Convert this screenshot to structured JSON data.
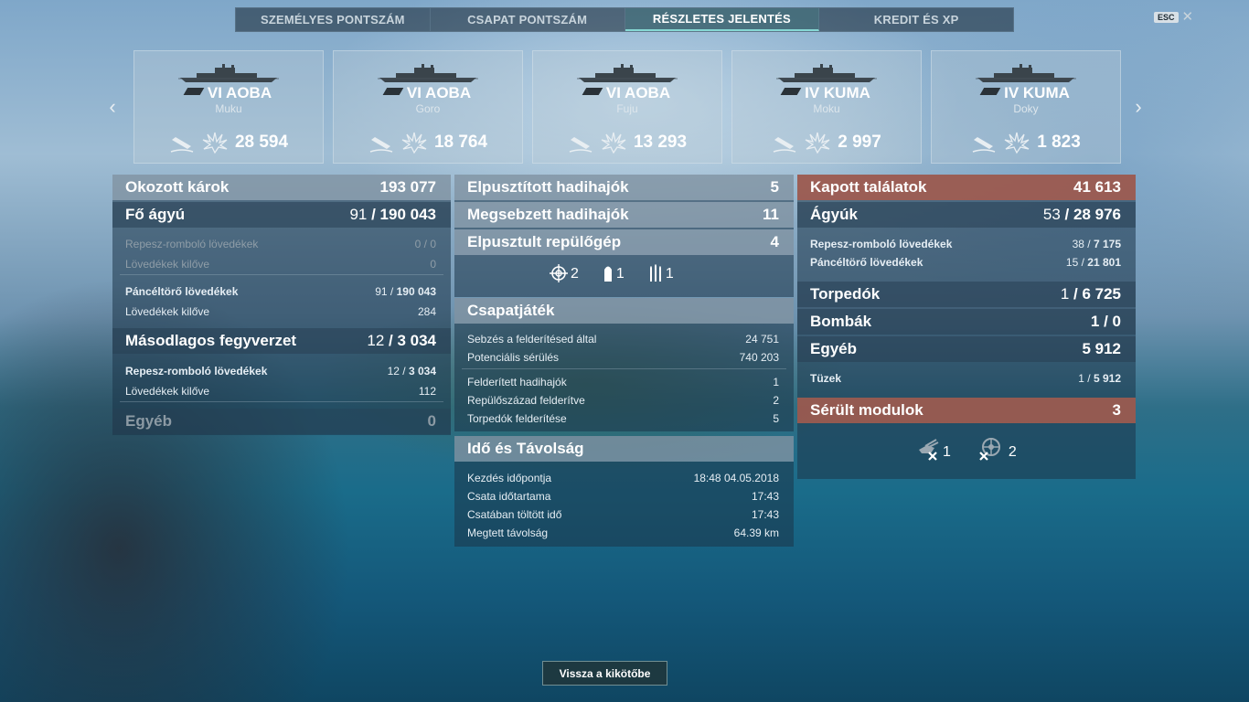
{
  "tabs": [
    "SZEMÉLYES PONTSZÁM",
    "CSAPAT PONTSZÁM",
    "RÉSZLETES JELENTÉS",
    "KREDIT ÉS XP"
  ],
  "active_tab": "RÉSZLETES JELENTÉS",
  "esc_label": "ESC",
  "close_symbol": "✕",
  "nav": {
    "prev": "‹",
    "next": "›"
  },
  "ships": [
    {
      "tier": "VI",
      "name": "AOBA",
      "player": "Muku",
      "damage": "28 594"
    },
    {
      "tier": "VI",
      "name": "AOBA",
      "player": "Goro",
      "damage": "18 764"
    },
    {
      "tier": "VI",
      "name": "AOBA",
      "player": "Fuju",
      "damage": "13 293"
    },
    {
      "tier": "IV",
      "name": "KUMA",
      "player": "Moku",
      "damage": "2 997"
    },
    {
      "tier": "IV",
      "name": "KUMA",
      "player": "Doky",
      "damage": "1 823"
    }
  ],
  "left": {
    "damage_caused": {
      "label": "Okozott károk",
      "value": "193 077"
    },
    "main_guns": {
      "label": "Fő ágyú",
      "hits": "91",
      "total": "190 043"
    },
    "he_main": {
      "label": "Repesz-romboló lövedékek",
      "value": "0 / 0"
    },
    "he_main_fired": {
      "label": "Lövedékek kilőve",
      "value": "0"
    },
    "ap_main": {
      "label": "Páncéltörő lövedékek",
      "hits": "91",
      "total": "190 043"
    },
    "ap_main_fired": {
      "label": "Lövedékek kilőve",
      "value": "284"
    },
    "secondary": {
      "label": "Másodlagos fegyverzet",
      "hits": "12",
      "total": "3 034"
    },
    "he_secondary": {
      "label": "Repesz-romboló lövedékek",
      "hits": "12",
      "total": "3 034"
    },
    "he_secondary_fired": {
      "label": "Lövedékek kilőve",
      "value": "112"
    },
    "other": {
      "label": "Egyéb",
      "value": "0"
    }
  },
  "middle": {
    "destroyed": {
      "label": "Elpusztított hadihajók",
      "value": "5"
    },
    "damaged": {
      "label": "Megsebzett hadihajók",
      "value": "11"
    },
    "planes": {
      "label": "Elpusztult repülőgép",
      "value": "4"
    },
    "medals": {
      "kill_count": "2",
      "shell_count": "1",
      "torpedo_count": "1"
    },
    "teamplay": {
      "title": "Csapatjáték",
      "spotting_damage": {
        "label": "Sebzés a felderítésed által",
        "value": "24 751"
      },
      "potential": {
        "label": "Potenciális sérülés",
        "value": "740 203"
      },
      "spotted_ships": {
        "label": "Felderített hadihajók",
        "value": "1"
      },
      "spotted_squadrons": {
        "label": "Repülőszázad felderítve",
        "value": "2"
      },
      "spotted_torpedoes": {
        "label": "Torpedók felderítése",
        "value": "5"
      }
    },
    "time": {
      "title": "Idő és Távolság",
      "start": {
        "label": "Kezdés időpontja",
        "value": "18:48  04.05.2018"
      },
      "duration": {
        "label": "Csata időtartama",
        "value": "17:43"
      },
      "in_battle": {
        "label": "Csatában töltött idő",
        "value": "17:43"
      },
      "distance": {
        "label": "Megtett távolság",
        "value": "64.39 km"
      }
    }
  },
  "right": {
    "hits_received": {
      "label": "Kapott találatok",
      "value": "41 613"
    },
    "guns": {
      "label": "Ágyúk",
      "hits": "53",
      "total": "28 976"
    },
    "he": {
      "label": "Repesz-romboló lövedékek",
      "hits": "38",
      "total": "7 175"
    },
    "ap": {
      "label": "Páncéltörő lövedékek",
      "hits": "15",
      "total": "21 801"
    },
    "torpedoes": {
      "label": "Torpedók",
      "hits": "1",
      "total": "6 725"
    },
    "bombs": {
      "label": "Bombák",
      "value": "1 / 0"
    },
    "other": {
      "label": "Egyéb",
      "value": "5 912"
    },
    "fires": {
      "label": "Tüzek",
      "hits": "1",
      "total": "5 912"
    },
    "modules": {
      "label": "Sérült modulok",
      "value": "3"
    },
    "module_icons": {
      "gun_count": "1",
      "engine_count": "2"
    }
  },
  "back_button": "Vissza a kikötőbe",
  "colors": {
    "accent": "#86d8d4",
    "damage_header": "#a85c4e"
  }
}
